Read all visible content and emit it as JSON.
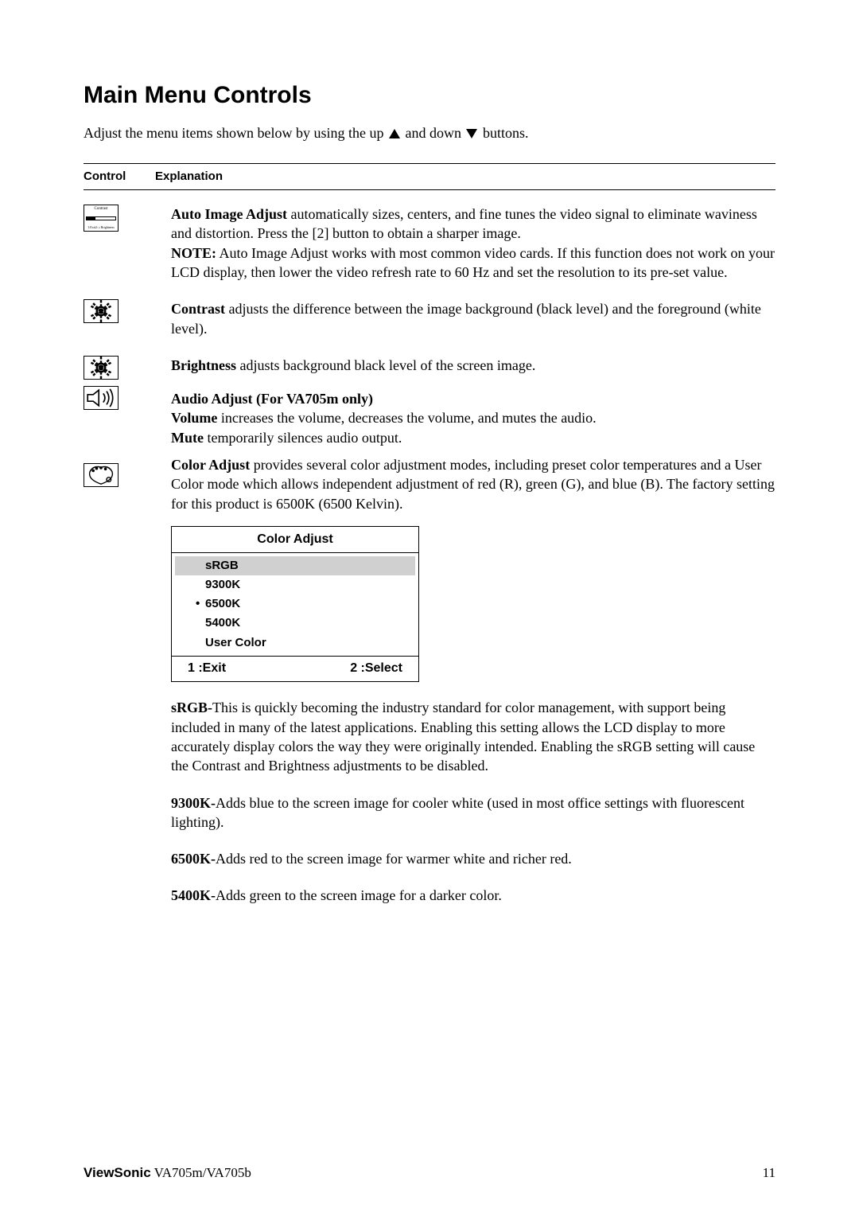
{
  "heading": "Main Menu Controls",
  "intro_pre": "Adjust the menu items shown below by using the up ",
  "intro_mid": " and down ",
  "intro_post": " buttons.",
  "th_control": "Control",
  "th_explanation": "Explanation",
  "auto_image": {
    "title": "Auto Image Adjust",
    "text1": " automatically sizes, centers, and fine tunes the video signal to eliminate waviness and distortion. Press the [2] button to obtain a sharper image.",
    "note_label": "NOTE:",
    "note_text": " Auto Image Adjust works with most common video cards. If this function does not work on your LCD display, then lower the video refresh rate to 60 Hz and set the resolution to its pre-set value."
  },
  "contrast": {
    "title": "Contrast",
    "text": " adjusts the difference between the image background  (black level) and the foreground (white level)."
  },
  "brightness": {
    "title": "Brightness",
    "text": " adjusts background black level of the screen image."
  },
  "audio": {
    "title": "Audio Adjust (For VA705m only)",
    "vol_label": "Volume",
    "vol_text": " increases the volume, decreases the volume, and mutes the audio.",
    "mute_label": "Mute",
    "mute_text": " temporarily silences audio output."
  },
  "color": {
    "title": "Color Adjust",
    "text": " provides several color adjustment modes, including preset color temperatures and a User Color mode which allows independent adjustment of red (R), green (G), and blue (B). The factory setting for this product is 6500K (6500 Kelvin)."
  },
  "color_adjust_box": {
    "title": "Color Adjust",
    "items": [
      "sRGB",
      "9300K",
      "6500K",
      "5400K",
      "User Color"
    ],
    "marker_index": 2,
    "selected_index": 0,
    "footer_left": "1 :Exit",
    "footer_right": "2 :Select"
  },
  "srgb": {
    "title": "sRGB-",
    "text": "This is quickly becoming the industry standard for color management, with support being included in many of the latest applications. Enabling this setting allows the LCD display to more accurately display colors the way they were originally intended. Enabling the sRGB setting will cause the Contrast and Brightness adjustments to be disabled."
  },
  "k9300": {
    "title": "9300K-",
    "text": "Adds blue to the screen image for cooler white (used in most office settings with fluorescent lighting)."
  },
  "k6500": {
    "title": "6500K-",
    "text": "Adds red to the screen image for warmer white and richer red."
  },
  "k5400": {
    "title": "5400K-",
    "text": "Adds green to the screen image for a darker color."
  },
  "footer": {
    "brand": "ViewSonic",
    "model": "   VA705m/VA705b",
    "page": "11"
  }
}
